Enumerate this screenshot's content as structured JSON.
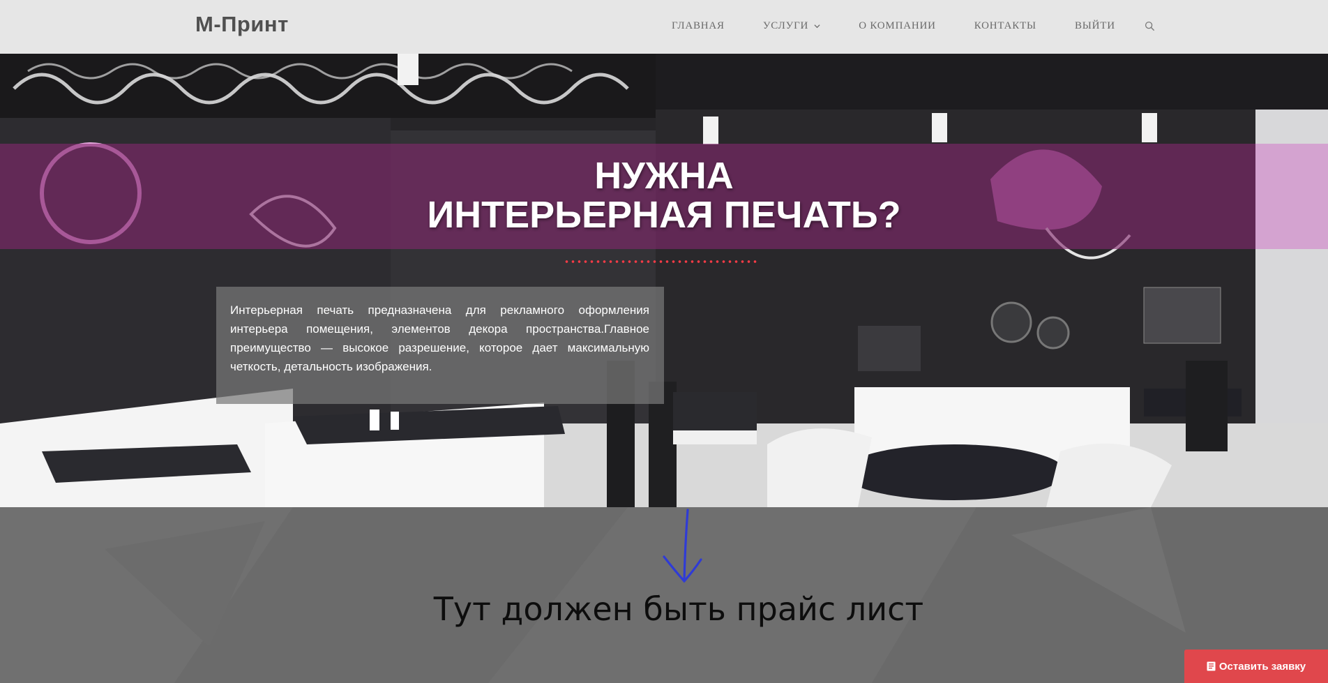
{
  "header": {
    "logo": "М-Принт",
    "nav": [
      "ГЛАВНАЯ",
      "УСЛУГИ",
      "О КОМПАНИИ",
      "КОНТАКТЫ",
      "ВЫЙТИ"
    ],
    "icons": {
      "services": "chevron-down-icon",
      "search": "search-icon"
    }
  },
  "hero": {
    "title_line1": "НУЖНА",
    "title_line2": "ИНТЕРЬЕРНАЯ ПЕЧАТЬ?",
    "description": "Интерьерная печать предназначена для рекламного оформления интерьера помещения, элементов декора пространства.Главное преимущество — высокое разрешение, которое дает максимальную четкость, детальность изображения."
  },
  "annotation": {
    "arrow_icon": "arrow-down-icon",
    "note": "Тут должен быть прайс лист"
  },
  "cta": {
    "label": "Оставить заявку",
    "icon": "document-icon"
  },
  "colors": {
    "header_bg": "#e6e6e6",
    "banner": "#82286e",
    "cta": "#e0474c",
    "dots": "#ff3b46",
    "arrow": "#2f3bd6",
    "lower_bg": "#6e6e6e"
  }
}
